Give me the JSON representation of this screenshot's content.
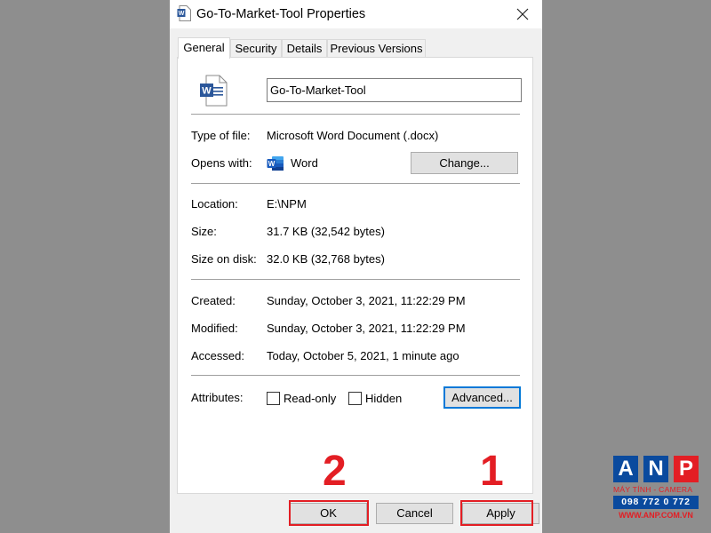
{
  "window": {
    "title": "Go-To-Market-Tool Properties"
  },
  "tabs": [
    {
      "label": "General",
      "active": true
    },
    {
      "label": "Security",
      "active": false
    },
    {
      "label": "Details",
      "active": false
    },
    {
      "label": "Previous Versions",
      "active": false
    }
  ],
  "general": {
    "file_name": "Go-To-Market-Tool",
    "type_of_file": {
      "label": "Type of file:",
      "value": "Microsoft Word Document (.docx)"
    },
    "opens_with": {
      "label": "Opens with:",
      "value": "Word",
      "change_label": "Change..."
    },
    "location": {
      "label": "Location:",
      "value": "E:\\NPM"
    },
    "size": {
      "label": "Size:",
      "value": "31.7 KB (32,542 bytes)"
    },
    "size_on_disk": {
      "label": "Size on disk:",
      "value": "32.0 KB (32,768 bytes)"
    },
    "created": {
      "label": "Created:",
      "value": "Sunday, October 3, 2021, 11:22:29 PM"
    },
    "modified": {
      "label": "Modified:",
      "value": "Sunday, October 3, 2021, 11:22:29 PM"
    },
    "accessed": {
      "label": "Accessed:",
      "value": "Today, October 5, 2021, 1 minute ago"
    },
    "attributes": {
      "label": "Attributes:",
      "read_only_label": "Read-only",
      "read_only_checked": false,
      "hidden_label": "Hidden",
      "hidden_checked": false,
      "advanced_label": "Advanced..."
    }
  },
  "footer": {
    "ok_label": "OK",
    "cancel_label": "Cancel",
    "apply_label": "Apply"
  },
  "annotations": {
    "step_ok": "2",
    "step_apply": "1",
    "highlight_color": "#e31e24"
  },
  "watermark": {
    "letters": [
      "A",
      "N",
      "P"
    ],
    "tagline": "MÁY TÍNH - CAMERA",
    "phone": "098 772 0 772",
    "url": "WWW.ANP.COM.VN"
  },
  "colors": {
    "word_blue": "#2b579a",
    "focus_blue": "#0078d7",
    "dialog_bg": "#f0f0f0",
    "backdrop": "#8e8e8e"
  }
}
